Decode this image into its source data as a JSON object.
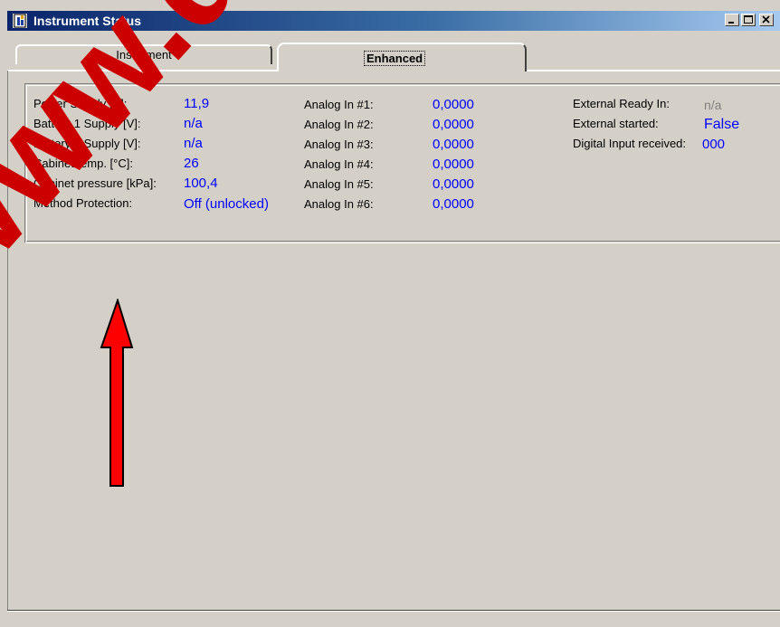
{
  "window": {
    "title": "Instrument Status",
    "minimize_glyph": "_",
    "maximize_glyph": "□",
    "close_glyph": "×"
  },
  "tabs": [
    {
      "label": "Instrument",
      "selected": false
    },
    {
      "label": "Enhanced",
      "selected": true
    }
  ],
  "column1": {
    "items": [
      {
        "label": "Power Supply [V]:",
        "value": "11,9"
      },
      {
        "label": "Battery 1 Supply [V]:",
        "value": "n/a"
      },
      {
        "label": "Battery 2 Supply [V]:",
        "value": "n/a"
      },
      {
        "label": "Cabinet temp. [°C]:",
        "value": "26"
      },
      {
        "label": "Cabinet pressure [kPa]:",
        "value": "100,4"
      },
      {
        "label": "Method Protection:",
        "value": "Off (unlocked)"
      }
    ]
  },
  "column2": {
    "items": [
      {
        "label": "Analog In #1:",
        "value": "0,0000"
      },
      {
        "label": "Analog In #2:",
        "value": "0,0000"
      },
      {
        "label": "Analog In #3:",
        "value": "0,0000"
      },
      {
        "label": "Analog In #4:",
        "value": "0,0000"
      },
      {
        "label": "Analog In #5:",
        "value": "0,0000"
      },
      {
        "label": "Analog In #6:",
        "value": "0,0000"
      }
    ]
  },
  "column3": {
    "items": [
      {
        "label": "External Ready In:",
        "value": "n/a"
      },
      {
        "label": "External started:",
        "value": "False"
      },
      {
        "label": "Digital Input received:",
        "value": "000"
      }
    ]
  },
  "overlay": {
    "watermark_text": "www.dc",
    "watermark_color": "#cc0000",
    "arrow_color": "#ff0000"
  },
  "colors": {
    "value_blue": "#0000ff",
    "na_gray": "#808080",
    "face": "#d4d0c8",
    "title_dark": "#0a246a"
  }
}
